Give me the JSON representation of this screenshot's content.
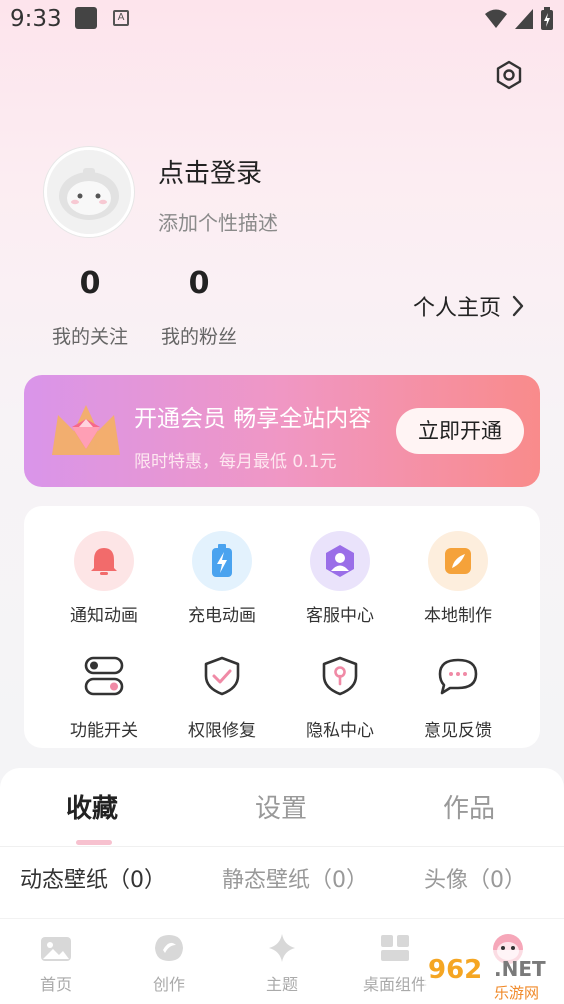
{
  "status_bar": {
    "time": "9:33",
    "a_label": "A"
  },
  "profile": {
    "login_text": "点击登录",
    "description": "添加个性描述"
  },
  "stats": [
    {
      "value": "0",
      "label": "我的关注"
    },
    {
      "value": "0",
      "label": "我的粉丝"
    }
  ],
  "profile_link": "个人主页",
  "vip": {
    "title": "开通会员 畅享全站内容",
    "subtitle": "限时特惠，每月最低 0.1元",
    "button": "立即开通"
  },
  "functions": [
    {
      "label": "通知动画",
      "icon": "bell-icon"
    },
    {
      "label": "充电动画",
      "icon": "battery-icon"
    },
    {
      "label": "客服中心",
      "icon": "customer-service-icon"
    },
    {
      "label": "本地制作",
      "icon": "pen-icon"
    },
    {
      "label": "功能开关",
      "icon": "toggle-icon"
    },
    {
      "label": "权限修复",
      "icon": "shield-check-icon"
    },
    {
      "label": "隐私中心",
      "icon": "privacy-lock-icon"
    },
    {
      "label": "意见反馈",
      "icon": "chat-bubble-icon"
    }
  ],
  "tabs": [
    "收藏",
    "设置",
    "作品"
  ],
  "subtabs": [
    "动态壁纸（0）",
    "静态壁纸（0）",
    "头像（0）"
  ],
  "nav": [
    "首页",
    "创作",
    "主题",
    "桌面组件"
  ],
  "watermark": {
    "number": "962",
    "net": ".NET",
    "site": "乐游网"
  },
  "colors": {
    "vip_start": "#d995ea",
    "vip_end": "#f98b8b",
    "accent_pink": "#f7c1cf"
  }
}
